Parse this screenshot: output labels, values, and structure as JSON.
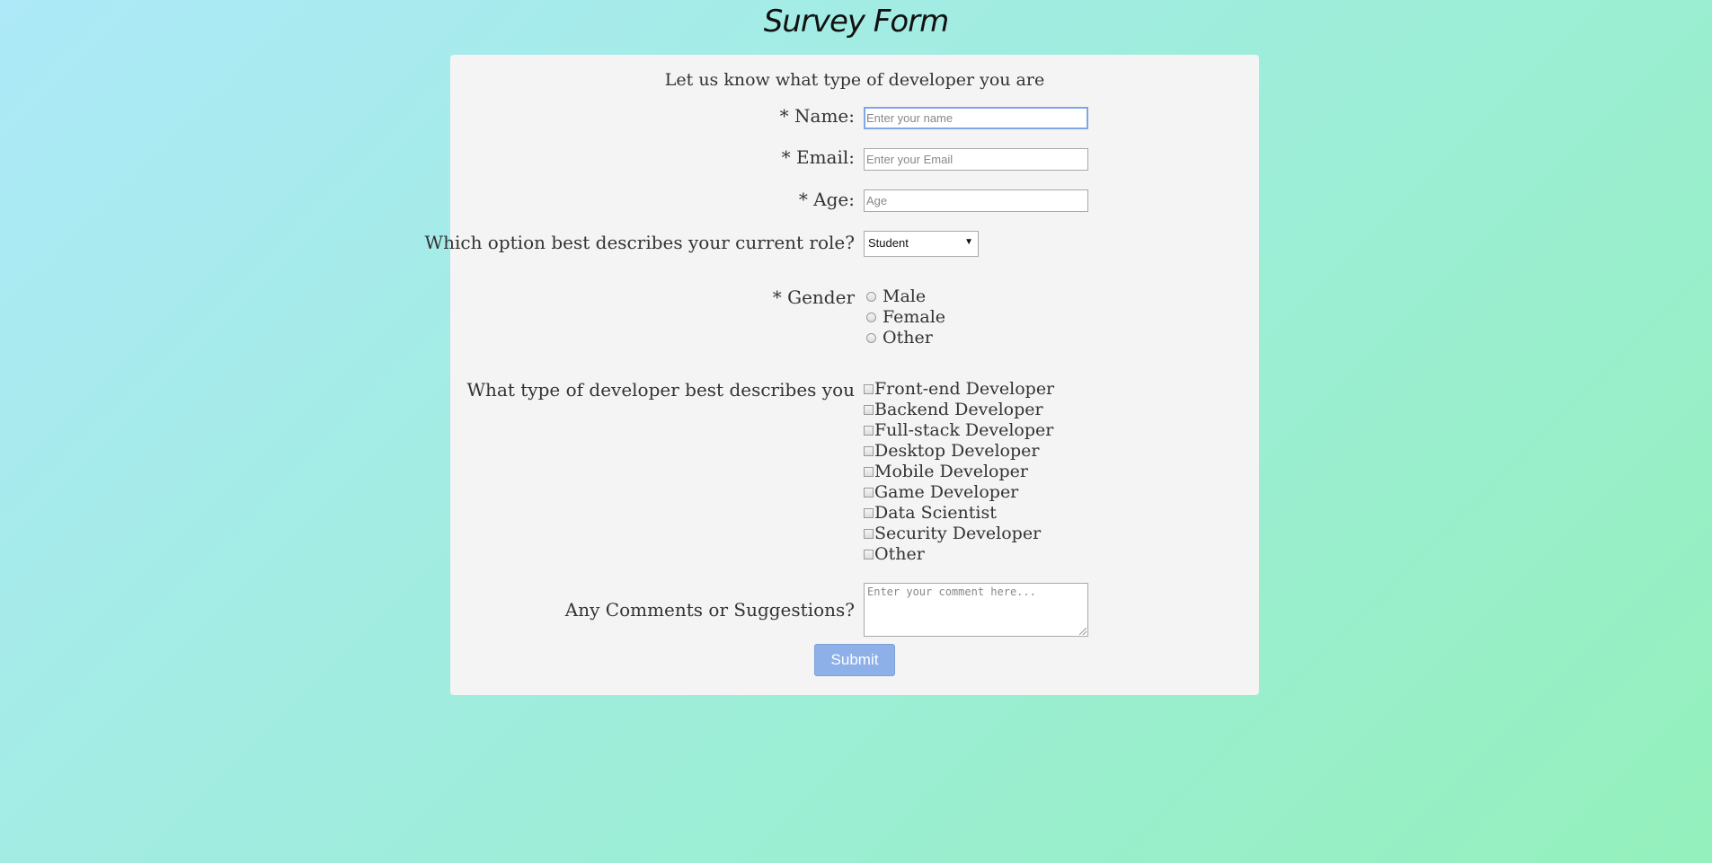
{
  "page": {
    "title": "Survey Form"
  },
  "form": {
    "subtitle": "Let us know what type of developer you are",
    "name": {
      "label": "* Name:",
      "placeholder": "Enter your name",
      "value": ""
    },
    "email": {
      "label": "* Email:",
      "placeholder": "Enter your Email",
      "value": ""
    },
    "age": {
      "label": "* Age:",
      "placeholder": "Age",
      "value": ""
    },
    "role": {
      "label": "Which option best describes your current role?",
      "selected": "Student"
    },
    "gender": {
      "label": "* Gender",
      "options": [
        "Male",
        "Female",
        "Other"
      ]
    },
    "developer_type": {
      "label": "What type of developer best describes you",
      "options": [
        "Front-end Developer",
        "Backend Developer",
        "Full-stack Developer",
        "Desktop Developer",
        "Mobile Developer",
        "Game Developer",
        "Data Scientist",
        "Security Developer",
        "Other"
      ]
    },
    "comments": {
      "label": "Any Comments or Suggestions?",
      "placeholder": "Enter your comment here..."
    },
    "submit_label": "Submit"
  },
  "colors": {
    "background_start": "#ade9f8",
    "background_end": "#94f0bc",
    "card": "#f4f4f4",
    "submit_button": "#8eb0e8"
  }
}
